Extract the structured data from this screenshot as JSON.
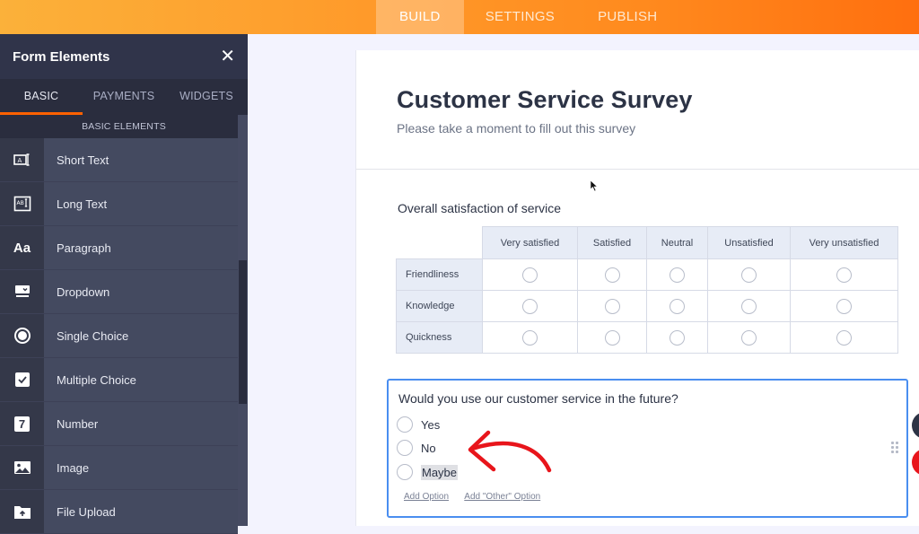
{
  "topbar": {
    "tabs": [
      {
        "label": "BUILD",
        "active": true
      },
      {
        "label": "SETTINGS",
        "active": false
      },
      {
        "label": "PUBLISH",
        "active": false
      }
    ]
  },
  "sidebar": {
    "title": "Form Elements",
    "close_icon": "close-icon",
    "tabs": [
      {
        "label": "BASIC",
        "active": true
      },
      {
        "label": "PAYMENTS",
        "active": false
      },
      {
        "label": "WIDGETS",
        "active": false
      }
    ],
    "section_label": "BASIC ELEMENTS",
    "items": [
      {
        "label": "Short Text",
        "icon": "short-text-icon"
      },
      {
        "label": "Long Text",
        "icon": "long-text-icon"
      },
      {
        "label": "Paragraph",
        "icon": "paragraph-icon",
        "glyph": "Aa"
      },
      {
        "label": "Dropdown",
        "icon": "dropdown-icon"
      },
      {
        "label": "Single Choice",
        "icon": "radio-icon"
      },
      {
        "label": "Multiple Choice",
        "icon": "checkbox-icon"
      },
      {
        "label": "Number",
        "icon": "number-icon",
        "glyph": "7"
      },
      {
        "label": "Image",
        "icon": "image-icon"
      },
      {
        "label": "File Upload",
        "icon": "file-upload-icon"
      }
    ]
  },
  "form": {
    "title": "Customer Service Survey",
    "subtitle": "Please take a moment to fill out this survey",
    "matrix_question": {
      "label": "Overall satisfaction of service",
      "columns": [
        "Very satisfied",
        "Satisfied",
        "Neutral",
        "Unsatisfied",
        "Very unsatisfied"
      ],
      "rows": [
        "Friendliness",
        "Knowledge",
        "Quickness"
      ]
    },
    "choice_question": {
      "label": "Would you use our customer service in the future?",
      "options": [
        "Yes",
        "No",
        "Maybe"
      ],
      "highlighted_option": "Maybe",
      "add_option_label": "Add Option",
      "add_other_label": "Add \"Other\" Option"
    }
  },
  "colors": {
    "accent_orange": "#ff6100",
    "selection_blue": "#4a8ef0",
    "annotation_red": "#e8151b"
  }
}
